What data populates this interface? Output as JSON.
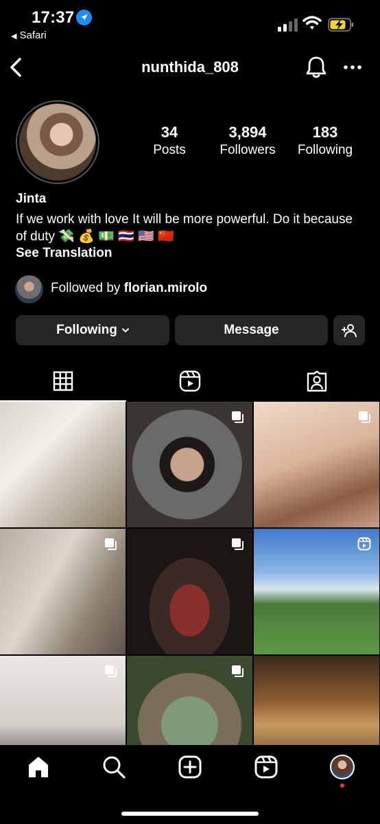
{
  "status_bar": {
    "time": "17:37",
    "back_app": "Safari",
    "battery_color": "#f5d428"
  },
  "header": {
    "username": "nunthida_808"
  },
  "profile": {
    "stats": [
      {
        "value": "34",
        "label": "Posts"
      },
      {
        "value": "3,894",
        "label": "Followers"
      },
      {
        "value": "183",
        "label": "Following"
      }
    ],
    "name": "Jinta",
    "bio": "If we work with love It will be more powerful. Do it because of duty 💸 💰 💵 🇹🇭 🇺🇸 🇨🇳",
    "see_translation": "See Translation",
    "followed_by_prefix": "Followed by",
    "followed_by_user": "florian.mirolo"
  },
  "buttons": {
    "following": "Following",
    "message": "Message"
  },
  "tabs": [
    {
      "name": "grid",
      "icon": "grid-icon",
      "active": true
    },
    {
      "name": "reels",
      "icon": "reels-icon",
      "active": false
    },
    {
      "name": "tagged",
      "icon": "tagged-icon",
      "active": false
    }
  ],
  "grid_posts": [
    {
      "badge": "none"
    },
    {
      "badge": "carousel-icon"
    },
    {
      "badge": "carousel-icon"
    },
    {
      "badge": "carousel-icon"
    },
    {
      "badge": "carousel-icon"
    },
    {
      "badge": "reel-icon"
    },
    {
      "badge": "carousel-icon"
    },
    {
      "badge": "carousel-icon"
    },
    {
      "badge": "none"
    }
  ],
  "bottom_nav": [
    "home-icon",
    "search-icon",
    "create-icon",
    "reels-icon",
    "profile-avatar"
  ],
  "colors": {
    "background": "#000000",
    "button_bg": "#262626",
    "accent_blue": "#1c8cf7",
    "notification_red": "#ff3040"
  }
}
